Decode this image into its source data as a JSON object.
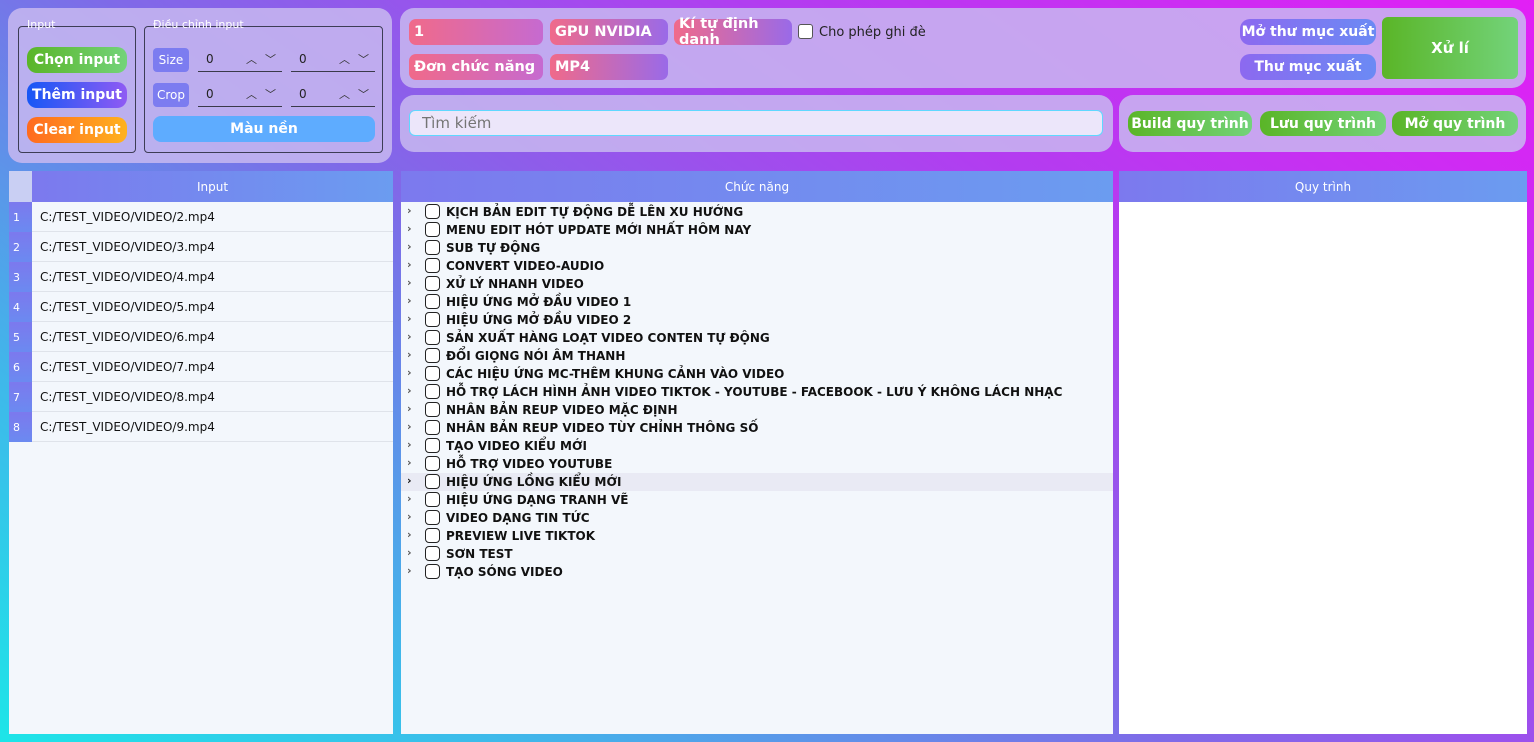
{
  "input_group": {
    "legend": "Input",
    "choose": "Chọn input",
    "add": "Thêm input",
    "clear": "Clear input"
  },
  "adjust_group": {
    "legend": "Điều chỉnh input",
    "size_label": "Size",
    "crop_label": "Crop",
    "size_w": "0",
    "size_h": "0",
    "crop_w": "0",
    "crop_h": "0",
    "bg_color": "Màu nền"
  },
  "toolbar": {
    "count": "1",
    "gpu": "GPU NVIDIA",
    "char_id": "Kí tự định danh",
    "overwrite_label": "Cho phép ghi đè",
    "mode": "Đơn chức năng",
    "format": "MP4",
    "open_output": "Mở thư mục xuất",
    "output_folder": "Thư mục xuất",
    "process": "Xử lí"
  },
  "search": {
    "placeholder": "Tìm kiếm"
  },
  "workflow_buttons": {
    "build": "Build quy trình",
    "save": "Lưu quy trình",
    "open": "Mở quy trình"
  },
  "input_table": {
    "header": "Input",
    "rows": [
      {
        "num": "1",
        "path": "C:/TEST_VIDEO/VIDEO/2.mp4"
      },
      {
        "num": "2",
        "path": "C:/TEST_VIDEO/VIDEO/3.mp4"
      },
      {
        "num": "3",
        "path": "C:/TEST_VIDEO/VIDEO/4.mp4"
      },
      {
        "num": "4",
        "path": "C:/TEST_VIDEO/VIDEO/5.mp4"
      },
      {
        "num": "5",
        "path": "C:/TEST_VIDEO/VIDEO/6.mp4"
      },
      {
        "num": "6",
        "path": "C:/TEST_VIDEO/VIDEO/7.mp4"
      },
      {
        "num": "7",
        "path": "C:/TEST_VIDEO/VIDEO/8.mp4"
      },
      {
        "num": "8",
        "path": "C:/TEST_VIDEO/VIDEO/9.mp4"
      }
    ]
  },
  "functions": {
    "header": "Chức năng",
    "items": [
      "KỊCH BẢN EDIT TỰ ĐỘNG DỄ LÊN XU HƯỚNG",
      "MENU EDIT HÓT UPDATE MỚI NHẤT HÔM NAY",
      "SUB TỰ ĐỘNG",
      "CONVERT  VIDEO-AUDIO",
      "XỬ LÝ NHANH VIDEO",
      "HIỆU ỨNG MỞ ĐẦU VIDEO 1",
      "HIỆU ỨNG MỞ ĐẦU VIDEO 2",
      "SẢN XUẤT HÀNG LOẠT VIDEO CONTEN TỰ ĐỘNG",
      "ĐỔI GIỌNG NÓI ÂM THANH",
      "CÁC HIỆU ỨNG MC-THÊM KHUNG CẢNH VÀO VIDEO",
      "HỖ TRỢ LÁCH HÌNH ẢNH VIDEO TIKTOK - YOUTUBE - FACEBOOK - LƯU Ý KHÔNG LÁCH NHẠC",
      "NHÂN BẢN REUP VIDEO MẶC ĐỊNH",
      "NHÂN BẢN REUP VIDEO TÙY CHỈNH THÔNG SỐ",
      "TẠO VIDEO KIỂU MỚI",
      "HỖ TRỢ VIDEO YOUTUBE",
      "HIỆU ỨNG LỒNG KIỂU MỚI",
      "HIỆU ỨNG DẠNG TRANH VẼ",
      "VIDEO  DẠNG TIN TỨC",
      "PREVIEW LIVE TIKTOK",
      "SƠN TEST",
      "TẠO SÓNG VIDEO"
    ]
  },
  "workflow": {
    "header": "Quy trình"
  },
  "colors": {
    "accent_green": "#5ab527",
    "accent_blue": "#1757f5",
    "accent_orange": "#ff6a1f",
    "header_purple": "#7c79ee"
  }
}
